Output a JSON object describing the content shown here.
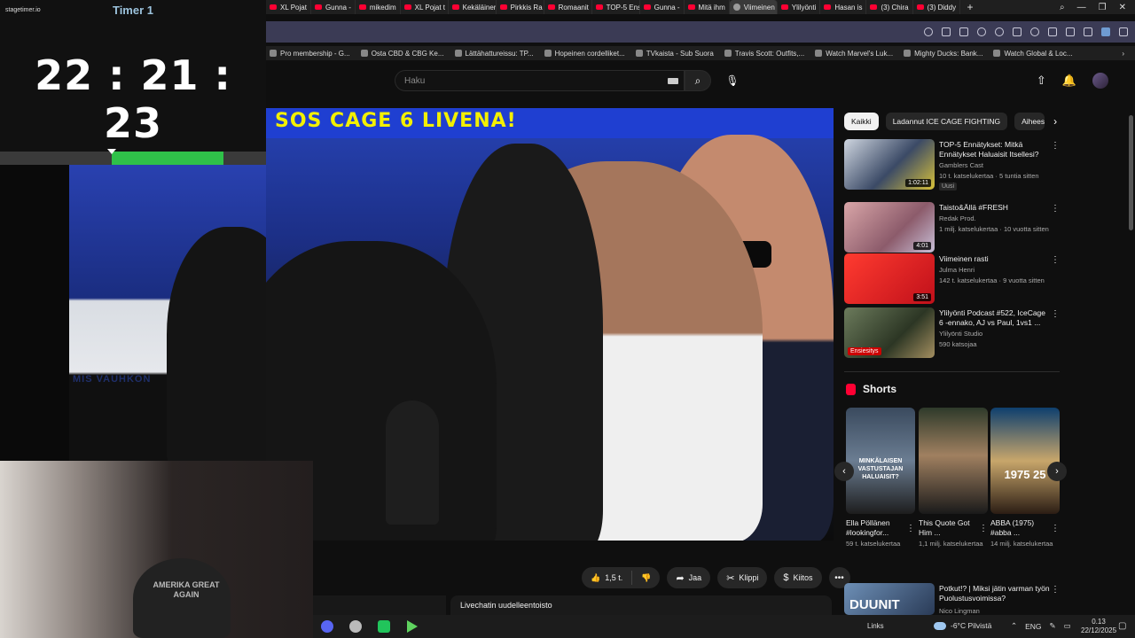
{
  "timer": {
    "brand": "stagetimer.io",
    "title": "Timer 1",
    "time": "22 : 21 : 23",
    "progress": 0.58
  },
  "browser": {
    "tabs": [
      {
        "label": "XL Pojat"
      },
      {
        "label": "Gunna -"
      },
      {
        "label": "mikedim"
      },
      {
        "label": "XL Pojat t"
      },
      {
        "label": "Kekäläinen"
      },
      {
        "label": "Pirkkis Ra"
      },
      {
        "label": "Romaanit"
      },
      {
        "label": "TOP-5 Ens"
      },
      {
        "label": "Gunna -"
      },
      {
        "label": "Mitä ihm"
      },
      {
        "label": "Viimeinen ra",
        "active": true
      },
      {
        "label": "Ylilyönti"
      },
      {
        "label": "Hasan is"
      },
      {
        "label": "(3) Chira"
      },
      {
        "label": "(3) Diddy"
      }
    ],
    "bookmarks": [
      {
        "label": "Pro membership - G..."
      },
      {
        "label": "Osta CBD & CBG Ke..."
      },
      {
        "label": "Lättähattureissu: TP..."
      },
      {
        "label": "Hopeinen cordelliket..."
      },
      {
        "label": "TVkaista - Sub Suora"
      },
      {
        "label": "Travis Scott: Outfits,..."
      },
      {
        "label": "Watch Marvel's Luk..."
      },
      {
        "label": "Mighty Ducks: Bank..."
      },
      {
        "label": "Watch Global & Loc..."
      }
    ]
  },
  "youtube": {
    "search": {
      "placeholder": "Haku"
    },
    "video": {
      "banner": "SOS  CAGE 6 LIVENA!",
      "lower_name": "MIS VAUHKON"
    },
    "actions": {
      "likes": "1,5 t.",
      "share": "Jaa",
      "clip": "Klippi",
      "thanks": "Kiitos"
    },
    "chat_replay": "Livechatin uudelleentoisto",
    "chips": [
      {
        "label": "Kaikki",
        "active": true
      },
      {
        "label": "Ladannut ICE CAGE FIGHTING"
      },
      {
        "label": "Aiheeseen"
      }
    ],
    "recommendations": [
      {
        "title": "TOP-5 Ennätykset: Mitkä Ennätykset Haluaisit Itsellesi?",
        "channel": "Gamblers Cast",
        "meta": "10 t. katselukertaa · 5 tuntia sitten",
        "badge": "Uusi",
        "duration": "1:02:11"
      },
      {
        "title": "Taisto&Ällä #FRESH",
        "channel": "Redak Prod.",
        "meta": "1 milj. katselukertaa · 10 vuotta sitten",
        "duration": "4:01"
      },
      {
        "title": "Viimeinen rasti",
        "channel": "Julma Henri",
        "meta": "142 t. katselukertaa · 9 vuotta sitten",
        "duration": "3:51"
      },
      {
        "title": "Ylilyönti Podcast #522, IceCage 6 -ennako, AJ vs Paul, 1vs1 ...",
        "channel": "Ylilyönti Studio",
        "meta": "590 katsojaa",
        "live": "Ensiesitys"
      }
    ],
    "shorts_title": "Shorts",
    "shorts": [
      {
        "title": "Ella Pöllänen #lookingfor...",
        "views": "59 t. katselukertaa",
        "thumb_text": "MINKÄLAISEN VASTUSTAJAN HALUAISIT?"
      },
      {
        "title": "This Quote Got Him ...",
        "views": "1,1 milj. katselukertaa",
        "thumb_text": ""
      },
      {
        "title": "ABBA (1975) #abba ...",
        "views": "14 milj. katselukertaa",
        "thumb_text": "1975 25"
      }
    ],
    "bottom_rec": {
      "title": "Potkut!? | Miksi jätin varman työn Puolustusvoimissa?",
      "channel": "Nico Lingman",
      "thumb_text": "DUUNIT"
    }
  },
  "webcam": {
    "cap_text": "AMERIKA GREAT AGAIN"
  },
  "taskbar": {
    "links": "Links",
    "weather": "-6°C  Pilvistä",
    "lang": "ENG",
    "time": "0.13",
    "date": "22/12/2025"
  }
}
